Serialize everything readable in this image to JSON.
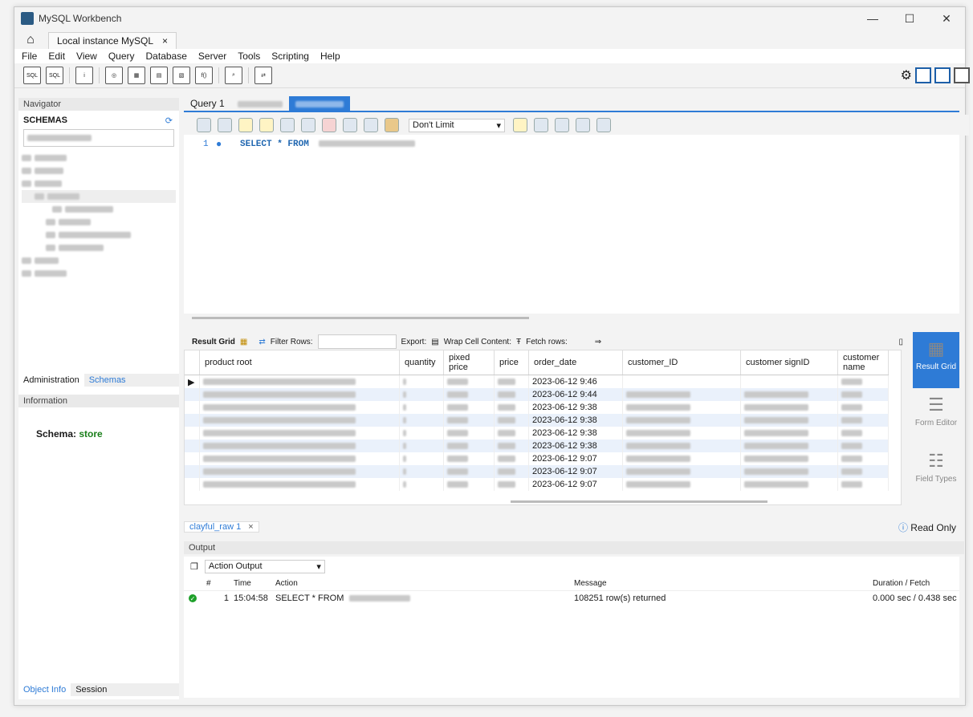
{
  "window": {
    "title": "MySQL Workbench",
    "minimize": "—",
    "maximize": "☐",
    "close": "✕"
  },
  "connection_tab": {
    "label": "Local instance MySQL",
    "close": "×"
  },
  "menu": [
    "File",
    "Edit",
    "View",
    "Query",
    "Database",
    "Server",
    "Tools",
    "Scripting",
    "Help"
  ],
  "navigator": {
    "header": "Navigator",
    "schemas_label": "SCHEMAS",
    "filter_placeholder": "Filter objects",
    "tabs": [
      "Administration",
      "Schemas"
    ],
    "info_header": "Information",
    "schema_label": "Schema:",
    "schema_name": "store",
    "bottom_tabs": [
      "Object Info",
      "Session"
    ]
  },
  "query_tabs": [
    "Query 1"
  ],
  "editor": {
    "line_number": "1",
    "sql": "SELECT * FROM"
  },
  "edit_toolbar": {
    "limit": "Don't Limit"
  },
  "result_toolbar": {
    "result_grid": "Result Grid",
    "filter_rows": "Filter Rows:",
    "export": "Export:",
    "wrap": "Wrap Cell Content:",
    "fetch": "Fetch rows:"
  },
  "grid": {
    "columns": [
      "product root",
      "quantity",
      "pixed price",
      "price",
      "order_date",
      "customer_ID",
      "customer signID",
      "customer name"
    ],
    "rows": [
      {
        "order_date": "2023-06-12 9:46"
      },
      {
        "order_date": "2023-06-12 9:44"
      },
      {
        "order_date": "2023-06-12 9:38"
      },
      {
        "order_date": "2023-06-12 9:38"
      },
      {
        "order_date": "2023-06-12 9:38"
      },
      {
        "order_date": "2023-06-12 9:38"
      },
      {
        "order_date": "2023-06-12 9:07"
      },
      {
        "order_date": "2023-06-12 9:07"
      },
      {
        "order_date": "2023-06-12 9:07"
      }
    ]
  },
  "side_panel": [
    {
      "label": "Result Grid",
      "active": true
    },
    {
      "label": "Form Editor",
      "active": false
    },
    {
      "label": "Field Types",
      "active": false
    }
  ],
  "result_tab": {
    "label": "clayful_raw 1",
    "close": "×",
    "read_only": "Read Only"
  },
  "output": {
    "header": "Output",
    "selector": "Action Output",
    "columns": [
      "#",
      "Time",
      "Action",
      "Message",
      "Duration / Fetch"
    ],
    "row": {
      "num": "1",
      "time": "15:04:58",
      "action": "SELECT * FROM",
      "message": "108251 row(s) returned",
      "duration": "0.000 sec / 0.438 sec"
    }
  },
  "colors": {
    "accent": "#2e7bd6",
    "schema_name": "#1a7f1a"
  }
}
